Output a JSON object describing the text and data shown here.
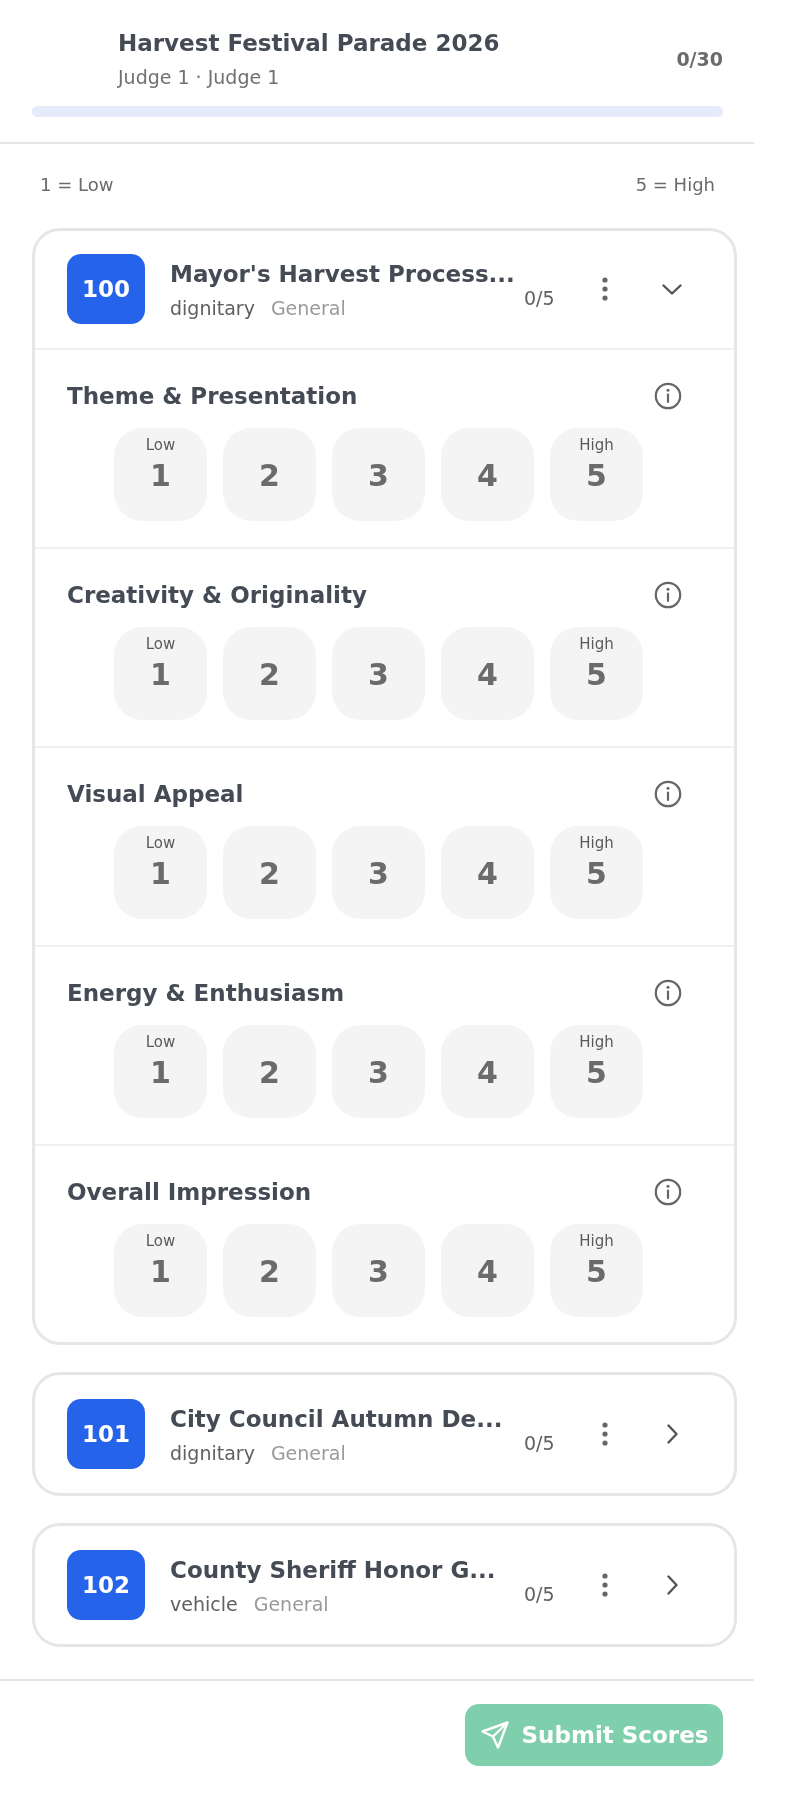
{
  "header": {
    "title": "Harvest Festival Parade 2026",
    "subtitle": "Judge 1 · Judge 1",
    "total": "0/30"
  },
  "legend": {
    "low": "1 = Low",
    "high": "5 = High"
  },
  "entries": [
    {
      "number": "100",
      "name": "Mayor's Harvest Process...",
      "category": "dignitary",
      "division": "General",
      "score": "0/5",
      "expanded": true,
      "criteria": [
        {
          "name": "Theme & Presentation",
          "scores": [
            {
              "value": "1",
              "hint": "Low",
              "selected": false
            },
            {
              "value": "2",
              "selected": false
            },
            {
              "value": "3",
              "selected": false
            },
            {
              "value": "4",
              "selected": false
            },
            {
              "value": "5",
              "hint": "High",
              "selected": false
            }
          ]
        },
        {
          "name": "Creativity & Originality",
          "scores": [
            {
              "value": "1",
              "hint": "Low",
              "selected": false
            },
            {
              "value": "2",
              "selected": false
            },
            {
              "value": "3",
              "selected": false
            },
            {
              "value": "4",
              "selected": false
            },
            {
              "value": "5",
              "hint": "High",
              "selected": false
            }
          ]
        },
        {
          "name": "Visual Appeal",
          "scores": [
            {
              "value": "1",
              "hint": "Low",
              "selected": false
            },
            {
              "value": "2",
              "selected": false
            },
            {
              "value": "3",
              "selected": false
            },
            {
              "value": "4",
              "selected": false
            },
            {
              "value": "5",
              "hint": "High",
              "selected": false
            }
          ]
        },
        {
          "name": "Energy & Enthusiasm",
          "scores": [
            {
              "value": "1",
              "hint": "Low",
              "selected": false
            },
            {
              "value": "2",
              "selected": false
            },
            {
              "value": "3",
              "selected": false
            },
            {
              "value": "4",
              "selected": false
            },
            {
              "value": "5",
              "hint": "High",
              "selected": false
            }
          ]
        },
        {
          "name": "Overall Impression",
          "scores": [
            {
              "value": "1",
              "hint": "Low",
              "selected": false
            },
            {
              "value": "2",
              "selected": false
            },
            {
              "value": "3",
              "selected": false
            },
            {
              "value": "4",
              "selected": false
            },
            {
              "value": "5",
              "hint": "High",
              "selected": false
            }
          ]
        }
      ]
    },
    {
      "number": "101",
      "name": "City Council Autumn De...",
      "category": "dignitary",
      "division": "General",
      "score": "0/5",
      "expanded": false
    },
    {
      "number": "102",
      "name": "County Sheriff Honor G...",
      "category": "vehicle",
      "division": "General",
      "score": "0/5",
      "expanded": false
    }
  ],
  "submit_button": {
    "label": "Submit Scores",
    "disabled": true
  }
}
